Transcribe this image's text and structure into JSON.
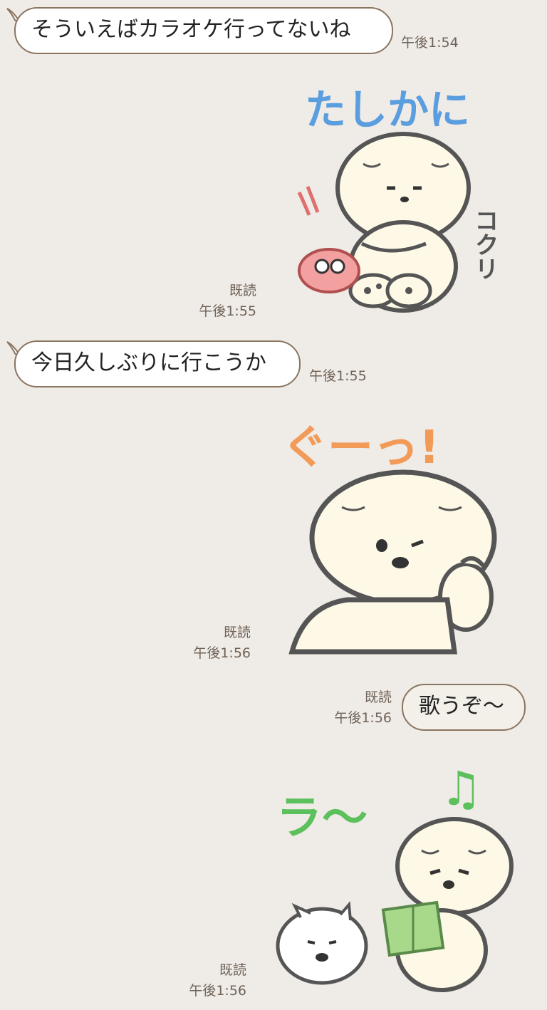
{
  "messages": [
    {
      "text": "そういえばカラオケ行ってないね",
      "time": "午後1:54"
    },
    {
      "sticker_caption": "たしかに",
      "sticker_sound": "コクリ",
      "read": "既読",
      "time": "午後1:55"
    },
    {
      "text": "今日久しぶりに行こうか",
      "time": "午後1:55"
    },
    {
      "sticker_caption": "ぐーっ!",
      "read": "既読",
      "time": "午後1:56"
    },
    {
      "text": "歌うぞ〜",
      "read": "既読",
      "time": "午後1:56"
    },
    {
      "sticker_caption": "ラ〜",
      "sticker_sound": "♫",
      "read": "既読",
      "time": "午後1:56"
    }
  ],
  "colors": {
    "background": "#efebe6",
    "bubble_border": "#8a7560",
    "caption_blue": "#5b9ee0",
    "caption_orange": "#f29a58",
    "caption_green": "#5cc05c"
  },
  "icons": [
    "bear-sticker-nodding-icon",
    "bear-sticker-thumbs-up-icon",
    "bear-sticker-singing-icon"
  ]
}
